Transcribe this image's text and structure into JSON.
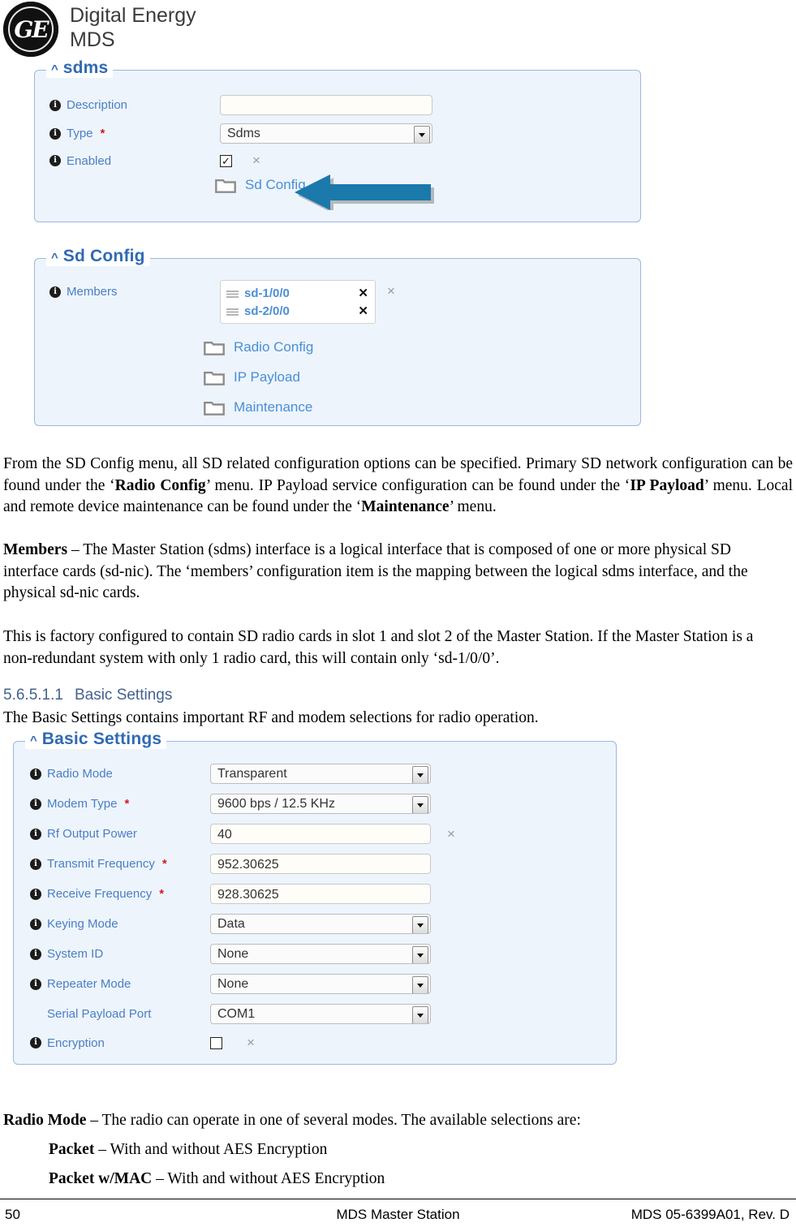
{
  "header": {
    "logo_alt": "GE",
    "brand_line1": "Digital Energy",
    "brand_line2": "MDS"
  },
  "sdms_panel": {
    "legend": "sdms",
    "caret": "^",
    "rows": {
      "description_label": "Description",
      "description_value": "",
      "type_label": "Type",
      "type_required": "*",
      "type_value": "Sdms",
      "enabled_label": "Enabled",
      "enabled_checked": "✓",
      "enabled_clear": "×"
    },
    "link_sd_config": "Sd Config"
  },
  "sdconfig_panel": {
    "legend": "Sd Config",
    "caret": "^",
    "members_label": "Members",
    "members": [
      {
        "name": "sd-1/0/0",
        "remove": "✕"
      },
      {
        "name": "sd-2/0/0",
        "remove": "✕"
      }
    ],
    "members_clear": "×",
    "links": [
      "Radio Config",
      "IP Payload",
      "Maintenance"
    ]
  },
  "body": {
    "para1_a": "From the SD Config menu, all SD related configuration options can be specified. Primary SD network configuration can be found under the ‘",
    "para1_b": "Radio Config",
    "para1_c": "’ menu. IP Payload service configuration can be found under the ‘",
    "para1_d": "IP Payload",
    "para1_e": "’ menu. Local and remote device maintenance can be found under the ‘",
    "para1_f": "Maintenance",
    "para1_g": "’ menu.",
    "members_term": "Members",
    "members_def": " – The Master Station (sdms) interface is a logical interface that is composed of one or more physical SD interface cards (sd-nic). The ‘members’ configuration item is the mapping between the logical sdms interface, and the physical sd-nic cards.",
    "para3": "This is factory configured to contain SD radio cards in slot 1 and slot 2 of the Master Station. If the Master Station is a non-redundant system with only 1 radio card, this will contain only ‘sd-1/0/0’.",
    "heading_number": "5.6.5.1.1",
    "heading_text": "Basic Settings",
    "para4": "The Basic Settings contains important RF and modem selections for radio operation."
  },
  "basic_settings_panel": {
    "legend": "Basic Settings",
    "caret": "^",
    "fields": [
      {
        "label": "Radio Mode",
        "required": "",
        "type": "select",
        "value": "Transparent",
        "clear": ""
      },
      {
        "label": "Modem Type",
        "required": "*",
        "type": "select",
        "value": "9600 bps / 12.5 KHz",
        "clear": ""
      },
      {
        "label": "Rf Output Power",
        "required": "",
        "type": "text",
        "value": "40",
        "clear": "×"
      },
      {
        "label": "Transmit Frequency",
        "required": "*",
        "type": "text",
        "value": "952.30625",
        "clear": ""
      },
      {
        "label": "Receive Frequency",
        "required": "*",
        "type": "text",
        "value": "928.30625",
        "clear": ""
      },
      {
        "label": "Keying Mode",
        "required": "",
        "type": "select",
        "value": "Data",
        "clear": ""
      },
      {
        "label": "System ID",
        "required": "",
        "type": "select",
        "value": "None",
        "clear": ""
      },
      {
        "label": "Repeater Mode",
        "required": "",
        "type": "select",
        "value": "None",
        "clear": ""
      },
      {
        "label": "Serial Payload Port",
        "required": "",
        "type": "select",
        "value": "COM1",
        "clear": "",
        "no_info": true
      },
      {
        "label": "Encryption",
        "required": "",
        "type": "checkbox",
        "value": "",
        "clear": "×"
      }
    ]
  },
  "tail": {
    "radio_mode_term": "Radio Mode",
    "radio_mode_def": " – The radio can operate in one of several modes. The available selections are:",
    "item1_term": "Packet",
    "item1_def": " – With and without AES Encryption",
    "item2_term": "Packet w/MAC",
    "item2_def": " – With and without AES Encryption"
  },
  "footer": {
    "page_number": "50",
    "center": "MDS Master Station",
    "right": "MDS 05-6399A01, Rev. D"
  },
  "colors": {
    "panel_bg": "#edf4fc",
    "panel_border": "#9cb8dd",
    "legend_blue": "#2f6ab4",
    "label_blue": "#4a7fc1",
    "link_blue": "#4a8fd4",
    "required_red": "#d01c1c",
    "arrow_blue": "#1b79ab",
    "heading_blue": "#44618f"
  }
}
